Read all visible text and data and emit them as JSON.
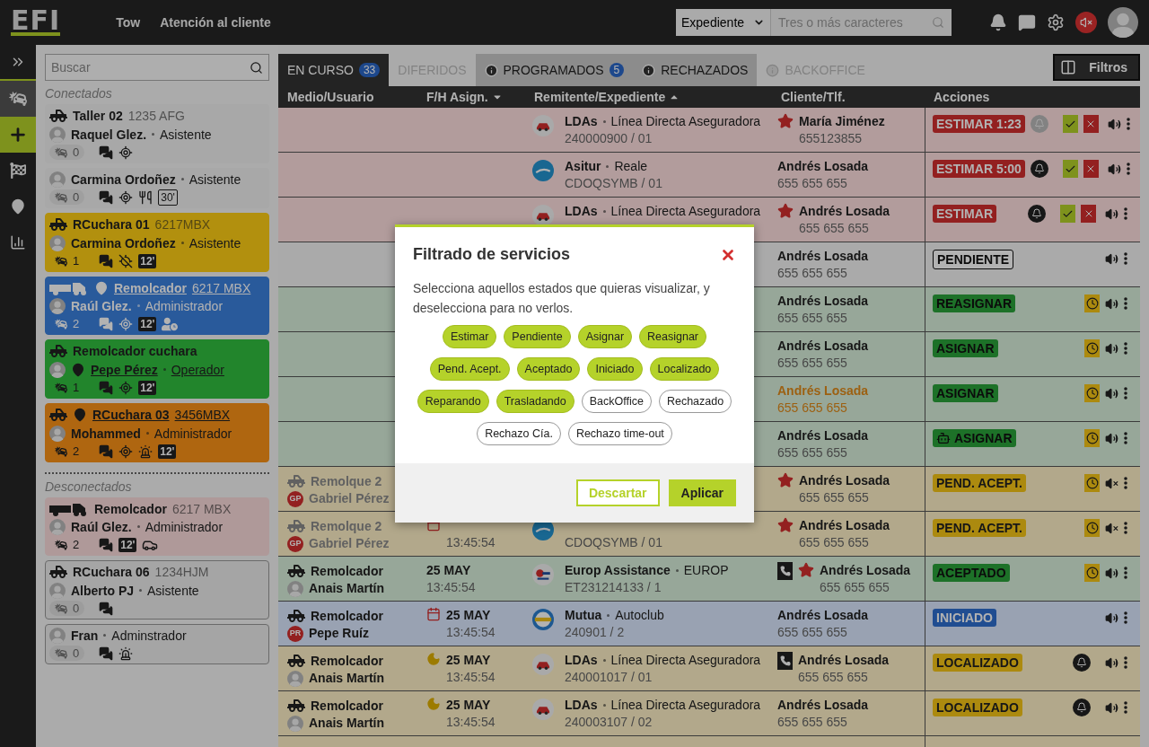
{
  "topbar": {
    "logo": "EFI",
    "nav": [
      "Tow",
      "Atención al cliente"
    ],
    "search_scope": "Expediente",
    "search": {
      "placeholder": "Tres o más caracteres"
    }
  },
  "rail": [
    {
      "kind": "expand",
      "selected": false
    },
    {
      "kind": "incidents",
      "selected": true
    },
    {
      "kind": "add",
      "selected": false
    },
    {
      "kind": "flag",
      "selected": false
    },
    {
      "kind": "map",
      "selected": false
    },
    {
      "kind": "stats",
      "selected": false
    }
  ],
  "sidebar": {
    "search": {
      "placeholder": "Buscar"
    },
    "groups": [
      {
        "title": "Conectados",
        "cards": [
          {
            "color": "#a9a9a9",
            "outlined": false,
            "vehicle": {
              "kind": "tow-truck",
              "name": "Taller 02",
              "plate": "1235 AFG",
              "link": false
            },
            "person": {
              "name": "Raquel Glez.",
              "role": "Asistente",
              "link": false
            },
            "count": "0",
            "count_active": false,
            "icons": [
              {
                "kind": "chat"
              },
              {
                "kind": "target"
              }
            ]
          },
          {
            "color": "#a9a9a9",
            "outlined": false,
            "person": {
              "name": "Carmina Ordoñez",
              "role": "Asistente",
              "link": false
            },
            "count": "0",
            "count_active": false,
            "icons": [
              {
                "kind": "chat"
              },
              {
                "kind": "target"
              },
              {
                "kind": "meal"
              },
              {
                "kind": "break",
                "text": "30'"
              }
            ]
          },
          {
            "color": "#b9910f",
            "outlined": false,
            "vehicle": {
              "kind": "tow-truck",
              "name": "RCuchara 01",
              "plate": "6217MBX",
              "link": false
            },
            "person": {
              "name": "Carmina Ordoñez",
              "role": "Asistente",
              "link": false
            },
            "count": "1",
            "count_active": true,
            "icons": [
              {
                "kind": "chat"
              },
              {
                "kind": "no-gps"
              },
              {
                "kind": "timer",
                "text": "12'"
              }
            ]
          },
          {
            "color": "#2a5a9c",
            "outlined": false,
            "vehicle": {
              "kind": "trailer-truck",
              "name": "Remolcador",
              "plate": "6217 MBX",
              "link": true
            },
            "person": {
              "name": "Raúl Glez.",
              "role": "Administrador",
              "link": false
            },
            "count": "2",
            "count_active": true,
            "icons": [
              {
                "kind": "chat"
              },
              {
                "kind": "target"
              },
              {
                "kind": "timer",
                "text": "12'"
              },
              {
                "kind": "user-clock"
              }
            ]
          },
          {
            "color": "#22862c",
            "outlined": false,
            "vehicle": {
              "kind": "tow-truck",
              "name": "Remolcador cuchara",
              "link": false
            },
            "person": {
              "name": "Pepe Pérez",
              "role": "Operador",
              "link": true
            },
            "count": "1",
            "count_active": true,
            "icons": [
              {
                "kind": "chat"
              },
              {
                "kind": "target"
              },
              {
                "kind": "timer",
                "text": "12'"
              }
            ]
          },
          {
            "color": "#b06610",
            "outlined": false,
            "vehicle": {
              "kind": "tow-truck",
              "name": "RCuchara 03",
              "plate": "3456MBX",
              "link": true
            },
            "person": {
              "name": "Mohammed",
              "role": "Administrador",
              "link": false
            },
            "count": "2",
            "count_active": true,
            "icons": [
              {
                "kind": "chat"
              },
              {
                "kind": "target"
              },
              {
                "kind": "siren"
              },
              {
                "kind": "timer",
                "text": "12'"
              }
            ]
          }
        ]
      },
      {
        "title": "Desconectados",
        "cards": [
          {
            "color": "#b09a9a",
            "outlined": false,
            "vehicle": {
              "kind": "trailer-truck",
              "name": "Remolcador",
              "plate": "6217 MBX",
              "link": false
            },
            "person": {
              "name": "Raúl Glez.",
              "role": "Administrador",
              "link": false
            },
            "count": "2",
            "count_active": true,
            "icons": [
              {
                "kind": "chat"
              },
              {
                "kind": "timer",
                "text": "12'"
              },
              {
                "kind": "cars"
              }
            ]
          },
          {
            "color": "#a5a5a5",
            "outlined": true,
            "vehicle": {
              "kind": "tow-truck",
              "name": "RCuchara 06",
              "plate": "1234HJM",
              "link": false
            },
            "person": {
              "name": "Alberto PJ",
              "role": "Asistente",
              "link": false
            },
            "count": "0",
            "count_active": false,
            "icons": [
              {
                "kind": "chat"
              }
            ]
          },
          {
            "color": "#a5a5a5",
            "outlined": true,
            "person": {
              "name": "Fran",
              "role": "Adminstrador",
              "link": false
            },
            "count": "0",
            "count_active": false,
            "icons": [
              {
                "kind": "chat"
              },
              {
                "kind": "siren"
              }
            ]
          }
        ]
      }
    ]
  },
  "tabs": [
    {
      "label": "EN CURSO",
      "count": "33",
      "selected": true,
      "disabled": false,
      "info": false
    },
    {
      "label": "DIFERIDOS",
      "selected": false,
      "disabled": true,
      "info": false
    },
    {
      "label": "PROGRAMADOS",
      "count": "5",
      "selected": false,
      "disabled": false,
      "info": true
    },
    {
      "label": "RECHAZADOS",
      "selected": false,
      "disabled": false,
      "info": true
    },
    {
      "label": "BACKOFFICE",
      "selected": false,
      "disabled": true,
      "info": true
    }
  ],
  "filters_button": "Filtros",
  "table": {
    "columns": [
      {
        "label": "Medio/Usuario",
        "kind": "plain"
      },
      {
        "label": "F/H Asign.",
        "kind": "sort-desc"
      },
      {
        "label": "Remitente/Expediente",
        "kind": "sort-asc"
      },
      {
        "label": "Cliente/Tlf.",
        "kind": "plain"
      },
      {
        "label": "Acciones",
        "kind": "plain"
      }
    ],
    "rows": [
      {
        "color": "#b59d9d",
        "sender": {
          "kind": "lda",
          "name": "LDAs",
          "company": "Línea Directa Aseguradora",
          "ref": "240000900 / 01"
        },
        "client": {
          "star": true,
          "phone": false,
          "highlight": false,
          "name": "María Jiménez",
          "tel": "655123855"
        },
        "status": {
          "kind": "red",
          "text": "ESTIMAR 1:23",
          "robot": false
        },
        "actions": [
          {
            "kind": "bell",
            "muted": true
          },
          {
            "kind": "accept"
          },
          {
            "kind": "reject"
          },
          {
            "kind": "sound",
            "muted": false
          },
          {
            "kind": "more"
          }
        ]
      },
      {
        "color": "#b59d9d",
        "sender": {
          "kind": "asitur",
          "name": "Asitur",
          "company": "Reale",
          "ref": "CDOQSYMB / 01"
        },
        "client": {
          "star": false,
          "phone": false,
          "highlight": false,
          "name": "Andrés Losada",
          "tel": "655 655 655"
        },
        "status": {
          "kind": "red",
          "text": "ESTIMAR 5:00",
          "robot": false
        },
        "actions": [
          {
            "kind": "bell",
            "muted": false
          },
          {
            "kind": "accept"
          },
          {
            "kind": "reject"
          },
          {
            "kind": "sound",
            "muted": false
          },
          {
            "kind": "more"
          }
        ]
      },
      {
        "color": "#b59d9d",
        "sender": {
          "kind": "lda",
          "name": "LDAs",
          "company": "Línea Directa Aseguradora"
        },
        "client": {
          "star": true,
          "phone": false,
          "highlight": false,
          "name": "Andrés Losada",
          "tel": "655 655 655"
        },
        "status": {
          "kind": "red",
          "text": "ESTIMAR",
          "robot": false
        },
        "actions": [
          {
            "kind": "bell",
            "muted": false
          },
          {
            "kind": "accept"
          },
          {
            "kind": "reject"
          },
          {
            "kind": "sound",
            "muted": false
          },
          {
            "kind": "more"
          }
        ]
      },
      {
        "color": "#ababab",
        "client": {
          "star": false,
          "phone": false,
          "highlight": false,
          "name": "Andrés Losada",
          "tel": "655 655 655"
        },
        "status": {
          "kind": "outline",
          "text": "PENDIENTE",
          "robot": false
        },
        "actions": [
          {
            "kind": "sound",
            "muted": false
          },
          {
            "kind": "more"
          }
        ]
      },
      {
        "color": "#98a89a",
        "client": {
          "star": false,
          "phone": false,
          "highlight": false,
          "name": "Andrés Losada",
          "tel": "655 655 655"
        },
        "status": {
          "kind": "green",
          "text": "REASIGNAR",
          "robot": false
        },
        "actions": [
          {
            "kind": "clock"
          },
          {
            "kind": "sound",
            "muted": false
          },
          {
            "kind": "more"
          }
        ]
      },
      {
        "color": "#98a89a",
        "client": {
          "star": false,
          "phone": false,
          "highlight": false,
          "name": "Andrés Losada",
          "tel": "655 655 655"
        },
        "status": {
          "kind": "green",
          "text": "ASIGNAR",
          "robot": false
        },
        "actions": [
          {
            "kind": "clock"
          },
          {
            "kind": "sound",
            "muted": false
          },
          {
            "kind": "more"
          }
        ]
      },
      {
        "color": "#98a89a",
        "client": {
          "star": false,
          "phone": false,
          "highlight": true,
          "name": "Andrés Losada",
          "tel": "655 655 655"
        },
        "status": {
          "kind": "green",
          "text": "ASIGNAR",
          "robot": false
        },
        "actions": [
          {
            "kind": "clock"
          },
          {
            "kind": "sound",
            "muted": false
          },
          {
            "kind": "more"
          }
        ]
      },
      {
        "color": "#98a89a",
        "client": {
          "star": false,
          "phone": false,
          "highlight": false,
          "name": "Andrés Losada",
          "tel": "655 655 655"
        },
        "status": {
          "kind": "green",
          "text": "ASIGNAR",
          "robot": true
        },
        "actions": [
          {
            "kind": "clock"
          },
          {
            "kind": "sound",
            "muted": false
          },
          {
            "kind": "more"
          }
        ]
      },
      {
        "color": "#b4a98c",
        "medio": {
          "vehicle": "Remolque 2",
          "person": "Gabriel Pérez",
          "faded": true,
          "avatar": {
            "kind": "initials",
            "text": "GP"
          }
        },
        "client": {
          "star": true,
          "phone": false,
          "highlight": false,
          "name": "Andrés Losada",
          "tel": "655 655 655"
        },
        "status": {
          "kind": "yellow",
          "text": "PEND. ACEPT.",
          "robot": false
        },
        "actions": [
          {
            "kind": "clock"
          },
          {
            "kind": "sound",
            "muted": true
          },
          {
            "kind": "more"
          }
        ]
      },
      {
        "color": "#b4a98c",
        "medio": {
          "vehicle": "Remolque 2",
          "person": "Gabriel Pérez",
          "faded": true,
          "avatar": {
            "kind": "initials",
            "text": "GP"
          }
        },
        "date": {
          "kind": "calendar",
          "time": "13:45:54"
        },
        "sender": {
          "kind": "asitur",
          "ref": "CDOQSYMB / 01"
        },
        "client": {
          "star": true,
          "phone": false,
          "highlight": false,
          "name": "Andrés Losada",
          "tel": "655 655 655"
        },
        "status": {
          "kind": "yellow",
          "text": "PEND. ACEPT.",
          "robot": false
        },
        "actions": [
          {
            "kind": "clock"
          },
          {
            "kind": "sound",
            "muted": true
          },
          {
            "kind": "more"
          }
        ]
      },
      {
        "color": "#98a89a",
        "medio": {
          "vehicle": "Remolcador",
          "person": "Anais Martín",
          "faded": false,
          "avatar": {
            "kind": "photo"
          }
        },
        "date": {
          "kind": "plain",
          "day": "25 MAY",
          "time": "13:45:54"
        },
        "sender": {
          "kind": "europ",
          "name": "Europ Assistance",
          "company": "EUROP",
          "ref": "ET231214133 / 1"
        },
        "client": {
          "star": true,
          "phone": true,
          "highlight": false,
          "name": "Andrés Losada",
          "tel": "655 655 655"
        },
        "status": {
          "kind": "green",
          "text": "ACEPTADO",
          "robot": false
        },
        "actions": [
          {
            "kind": "clock"
          },
          {
            "kind": "sound",
            "muted": false
          },
          {
            "kind": "more"
          }
        ]
      },
      {
        "color": "#9aa3b3",
        "medio": {
          "vehicle": "Remolcador",
          "person": "Pepe Ruíz",
          "faded": false,
          "avatar": {
            "kind": "initials",
            "text": "PR"
          }
        },
        "date": {
          "kind": "calendar",
          "day": "25 MAY",
          "time": "13:45:54"
        },
        "sender": {
          "kind": "mutua",
          "name": "Mutua",
          "company": "Autoclub",
          "ref": "240901 / 2"
        },
        "client": {
          "star": false,
          "phone": false,
          "highlight": false,
          "name": "Andrés Losada",
          "tel": "655 655 655"
        },
        "status": {
          "kind": "blue",
          "text": "INICIADO",
          "robot": false
        },
        "actions": [
          {
            "kind": "sound",
            "muted": false
          },
          {
            "kind": "more"
          }
        ]
      },
      {
        "color": "#b4a98c",
        "medio": {
          "vehicle": "Remolcador",
          "person": "Anais Martín",
          "faded": false,
          "avatar": {
            "kind": "photo"
          }
        },
        "date": {
          "kind": "night",
          "day": "25 MAY",
          "time": "13:45:54"
        },
        "sender": {
          "kind": "lda",
          "name": "LDAs",
          "company": "Línea Directa Aseguradora",
          "ref": "240001017 / 01"
        },
        "client": {
          "star": false,
          "phone": true,
          "highlight": false,
          "name": "Andrés Losada",
          "tel": "655 655 655"
        },
        "status": {
          "kind": "yellow",
          "text": "LOCALIZADO",
          "robot": false
        },
        "actions": [
          {
            "kind": "bell",
            "muted": false
          },
          {
            "kind": "sound",
            "muted": false
          },
          {
            "kind": "more"
          }
        ]
      },
      {
        "color": "#b4a98c",
        "medio": {
          "vehicle": "Remolcador",
          "person": "Anais Martín",
          "faded": false,
          "avatar": {
            "kind": "photo"
          }
        },
        "date": {
          "kind": "night",
          "day": "25 MAY",
          "time": "13:45:54"
        },
        "sender": {
          "kind": "lda",
          "name": "LDAs",
          "company": "Línea Directa Aseguradora",
          "ref": "240003107 / 02"
        },
        "client": {
          "star": false,
          "phone": false,
          "highlight": false,
          "name": "Andrés Losada",
          "tel": "655 655 655"
        },
        "status": {
          "kind": "yellow",
          "text": "LOCALIZADO",
          "robot": false
        },
        "actions": [
          {
            "kind": "bell",
            "muted": false
          },
          {
            "kind": "sound",
            "muted": false
          },
          {
            "kind": "more"
          }
        ]
      },
      {
        "color": "#b4a98c"
      }
    ]
  },
  "modal": {
    "title": "Filtrado de servicios",
    "text": "Selecciona aquellos estados que quieras visualizar, y deselecciona para no verlos.",
    "chips": [
      {
        "label": "Estimar",
        "selected": true
      },
      {
        "label": "Pendiente",
        "selected": true
      },
      {
        "label": "Asignar",
        "selected": true
      },
      {
        "label": "Reasignar",
        "selected": true
      },
      {
        "label": "Pend. Acept.",
        "selected": true
      },
      {
        "label": "Aceptado",
        "selected": true
      },
      {
        "label": "Iniciado",
        "selected": true
      },
      {
        "label": "Localizado",
        "selected": true
      },
      {
        "label": "Reparando",
        "selected": true
      },
      {
        "label": "Trasladando",
        "selected": true
      },
      {
        "label": "BackOffice",
        "selected": false
      },
      {
        "label": "Rechazado",
        "selected": false
      },
      {
        "label": "Rechazo Cía.",
        "selected": false
      },
      {
        "label": "Rechazo time-out",
        "selected": false
      }
    ],
    "buttons": [
      {
        "kind": "secondary",
        "label": "Descartar"
      },
      {
        "kind": "primary",
        "label": "Aplicar"
      }
    ]
  }
}
